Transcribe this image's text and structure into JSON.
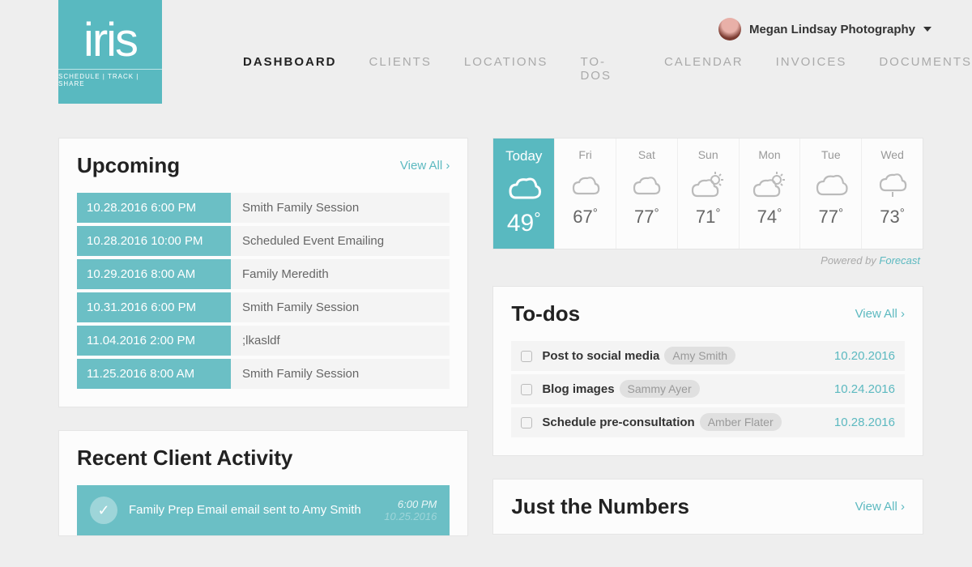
{
  "brand": {
    "name": "iris",
    "tagline": "SCHEDULE | TRACK | SHARE"
  },
  "account": {
    "name": "Megan Lindsay Photography"
  },
  "nav": {
    "items": [
      "DASHBOARD",
      "CLIENTS",
      "LOCATIONS",
      "TO-DOS",
      "CALENDAR",
      "INVOICES",
      "DOCUMENTS"
    ],
    "active": 0
  },
  "upcoming": {
    "title": "Upcoming",
    "viewall": "View All",
    "rows": [
      {
        "date": "10.28.2016 6:00 PM",
        "title": "Smith Family Session"
      },
      {
        "date": "10.28.2016 10:00 PM",
        "title": "Scheduled Event Emailing"
      },
      {
        "date": "10.29.2016 8:00 AM",
        "title": "Family Meredith"
      },
      {
        "date": "10.31.2016 6:00 PM",
        "title": "Smith Family Session"
      },
      {
        "date": "11.04.2016 2:00 PM",
        "title": ";lkasldf"
      },
      {
        "date": "11.25.2016 8:00 AM",
        "title": "Smith Family Session"
      }
    ]
  },
  "activity": {
    "title": "Recent Client Activity",
    "item": {
      "text": "Family Prep Email email sent to Amy Smith",
      "time": "6:00 PM",
      "date": "10.25.2016"
    }
  },
  "weather": {
    "powered_prefix": "Powered by ",
    "powered_link": "Forecast",
    "days": [
      {
        "label": "Today",
        "temp": "49",
        "icon": "cloud",
        "today": true
      },
      {
        "label": "Fri",
        "temp": "67",
        "icon": "partly"
      },
      {
        "label": "Sat",
        "temp": "77",
        "icon": "partly"
      },
      {
        "label": "Sun",
        "temp": "71",
        "icon": "partly-sun"
      },
      {
        "label": "Mon",
        "temp": "74",
        "icon": "partly-sun"
      },
      {
        "label": "Tue",
        "temp": "77",
        "icon": "cloud"
      },
      {
        "label": "Wed",
        "temp": "73",
        "icon": "rain"
      }
    ]
  },
  "todos": {
    "title": "To-dos",
    "viewall": "View All",
    "items": [
      {
        "text": "Post to social media",
        "client": "Amy Smith",
        "date": "10.20.2016"
      },
      {
        "text": "Blog images",
        "client": "Sammy Ayer",
        "date": "10.24.2016"
      },
      {
        "text": "Schedule pre-consultation",
        "client": "Amber Flater",
        "date": "10.28.2016"
      }
    ]
  },
  "numbers": {
    "title": "Just the Numbers",
    "viewall": "View All"
  }
}
